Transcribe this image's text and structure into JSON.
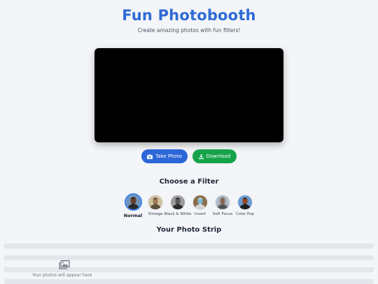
{
  "header": {
    "title": "Fun Photobooth",
    "subtitle": "Create amazing photos with fun filters!"
  },
  "actions": {
    "take_photo": "Take Photo",
    "download": "Download"
  },
  "filters": {
    "title": "Choose a Filter",
    "selected": "Normal",
    "items": [
      {
        "label": "Normal"
      },
      {
        "label": "Vintage"
      },
      {
        "label": "Black & White"
      },
      {
        "label": "Invert"
      },
      {
        "label": "Soft Focus"
      },
      {
        "label": "Color Pop"
      }
    ]
  },
  "strip": {
    "title": "Your Photo Strip",
    "empty_message": "Your photos will appear here"
  },
  "colors": {
    "brand": "#2f6ad6",
    "take_button": "#2c67d8",
    "download_button": "#16a34a",
    "selected_ring": "#3b82f6"
  }
}
